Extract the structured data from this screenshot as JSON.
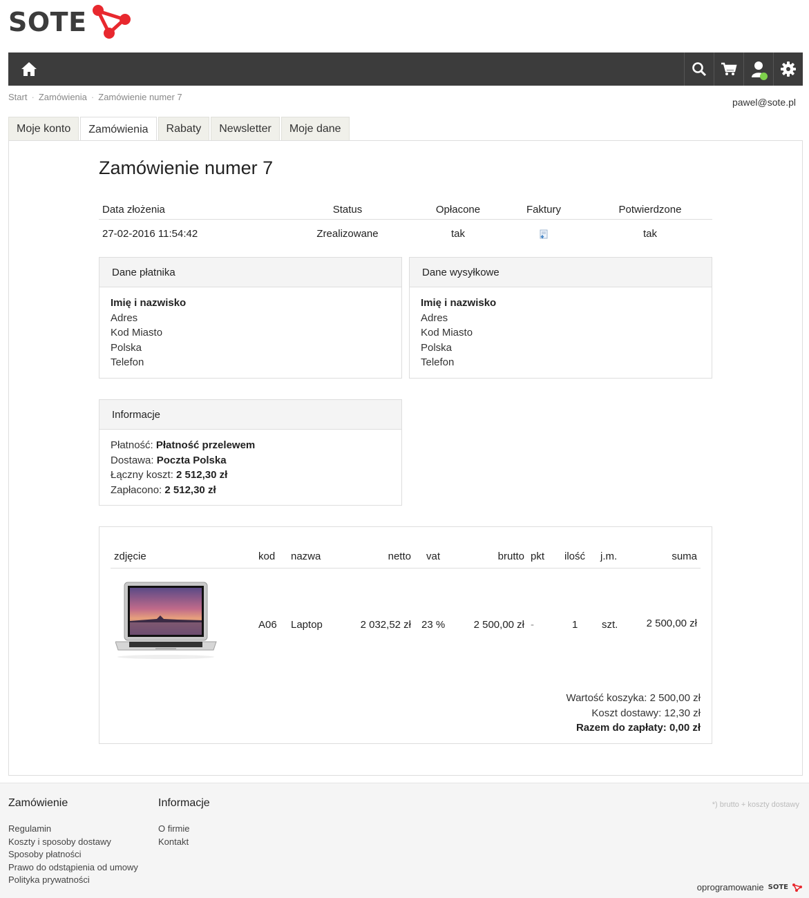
{
  "brand": {
    "logo_text": "SOTE",
    "accent": "#e8282e"
  },
  "nav": {
    "home_icon": "home-icon",
    "buttons": [
      "search-icon",
      "cart-icon",
      "user-icon",
      "gear-icon"
    ]
  },
  "breadcrumb": [
    "Start",
    "Zamówienia",
    "Zamówienie numer 7"
  ],
  "user_email": "pawel@sote.pl",
  "tabs": [
    "Moje konto",
    "Zamówienia",
    "Rabaty",
    "Newsletter",
    "Moje dane"
  ],
  "active_tab": "Zamówienia",
  "page_title": "Zamówienie numer 7",
  "summary": {
    "headers": [
      "Data złożenia",
      "Status",
      "Opłacone",
      "Faktury",
      "Potwierdzone"
    ],
    "date": "27-02-2016 11:54:42",
    "status": "Zrealizowane",
    "paid": "tak",
    "invoice_icon": "invoice-download-icon",
    "confirmed": "tak"
  },
  "payer": {
    "title": "Dane płatnika",
    "name": "Imię i nazwisko",
    "lines": [
      "Adres",
      "Kod Miasto",
      "Polska",
      "Telefon"
    ]
  },
  "shipping": {
    "title": "Dane wysyłkowe",
    "name": "Imię i nazwisko",
    "lines": [
      "Adres",
      "Kod Miasto",
      "Polska",
      "Telefon"
    ]
  },
  "info": {
    "title": "Informacje",
    "payment_label": "Płatność:",
    "payment_value": "Płatność przelewem",
    "delivery_label": "Dostawa:",
    "delivery_value": "Poczta Polska",
    "total_label": "Łączny koszt:",
    "total_value": "2 512,30 zł",
    "paid_label": "Zapłacono:",
    "paid_value": "2 512,30 zł"
  },
  "products": {
    "headers": [
      "zdjęcie",
      "kod",
      "nazwa",
      "netto",
      "vat",
      "brutto",
      "pkt",
      "ilość",
      "j.m.",
      "suma"
    ],
    "rows": [
      {
        "image": "laptop-image",
        "code": "A06",
        "name": "Laptop",
        "net": "2 032,52 zł",
        "vat": "23 %",
        "gross": "2 500,00 zł",
        "points": "-",
        "qty": "1",
        "unit": "szt.",
        "sum": "2 500,00 zł"
      }
    ],
    "cart_value": "Wartość koszyka: 2 500,00 zł",
    "shipping_cost": "Koszt dostawy: 12,30 zł",
    "total_to_pay": "Razem do zapłaty: 0,00 zł"
  },
  "footer": {
    "col1_title": "Zamówienie",
    "col1_links": [
      "Regulamin",
      "Koszty i sposoby dostawy",
      "Sposoby płatności",
      "Prawo do odstąpienia od umowy",
      "Polityka prywatności"
    ],
    "col2_title": "Informacje",
    "col2_links": [
      "O firmie",
      "Kontakt"
    ],
    "note": "*) brutto + koszty dostawy",
    "software_label": "oprogramowanie",
    "software_brand": "SOTE"
  }
}
